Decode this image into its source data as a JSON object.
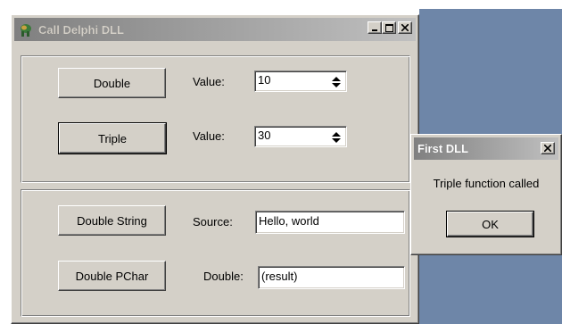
{
  "main_window": {
    "title": "Call Delphi DLL",
    "group_top": {
      "double_button": "Double",
      "triple_button": "Triple",
      "value_label_1": "Value:",
      "value_1": "10",
      "value_label_2": "Value:",
      "value_2": "30"
    },
    "group_bottom": {
      "double_string_button": "Double String",
      "double_pchar_button": "Double PChar",
      "source_label": "Source:",
      "source_value": "Hello, world",
      "double_label": "Double:",
      "double_value": "(result)"
    }
  },
  "dialog": {
    "title": "First DLL",
    "message": "Triple function called",
    "ok_button": "OK"
  },
  "colors": {
    "face": "#d4d0c8",
    "desktop": "#6e86a8",
    "titlebar_inactive": "#808080"
  },
  "icons": [
    "app-icon",
    "minimize-icon",
    "maximize-icon",
    "close-icon",
    "spin-arrows-icon"
  ]
}
